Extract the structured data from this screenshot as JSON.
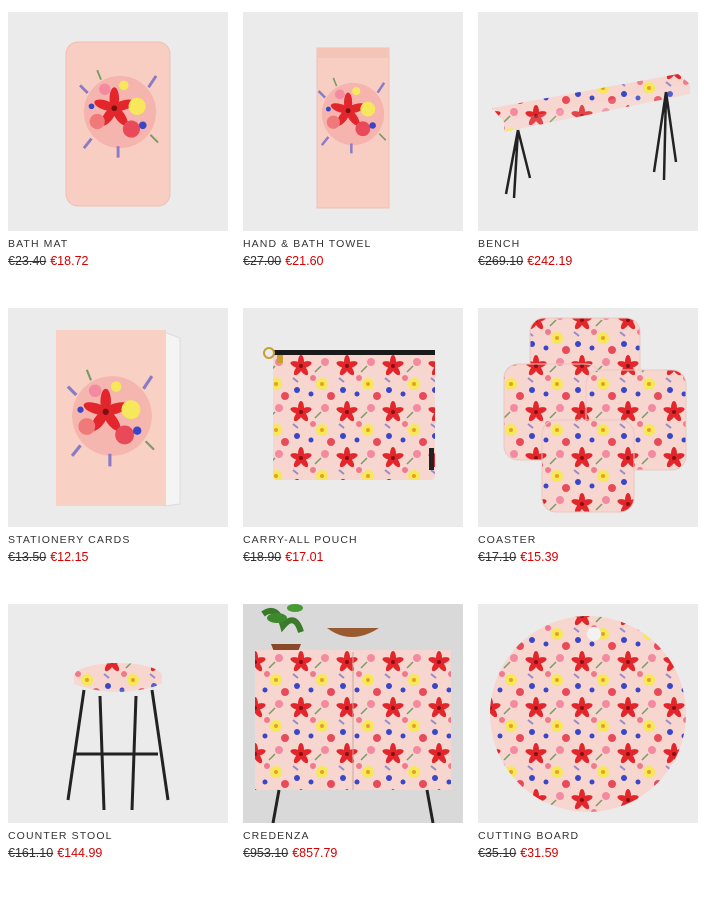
{
  "colors": {
    "sale_price": "#d60000",
    "original_price": "#333333",
    "thumb_background": "#ebebeb"
  },
  "products": [
    {
      "name": "BATH MAT",
      "original_price": "€23.40",
      "sale_price": "€18.72",
      "image": "bath-mat-image"
    },
    {
      "name": "HAND & BATH TOWEL",
      "original_price": "€27.00",
      "sale_price": "€21.60",
      "image": "towel-image"
    },
    {
      "name": "BENCH",
      "original_price": "€269.10",
      "sale_price": "€242.19",
      "image": "bench-image"
    },
    {
      "name": "STATIONERY CARDS",
      "original_price": "€13.50",
      "sale_price": "€12.15",
      "image": "stationery-card-image"
    },
    {
      "name": "CARRY-ALL POUCH",
      "original_price": "€18.90",
      "sale_price": "€17.01",
      "image": "pouch-image"
    },
    {
      "name": "COASTER",
      "original_price": "€17.10",
      "sale_price": "€15.39",
      "image": "coaster-image"
    },
    {
      "name": "COUNTER STOOL",
      "original_price": "€161.10",
      "sale_price": "€144.99",
      "image": "counter-stool-image"
    },
    {
      "name": "CREDENZA",
      "original_price": "€953.10",
      "sale_price": "€857.79",
      "image": "credenza-image"
    },
    {
      "name": "CUTTING BOARD",
      "original_price": "€35.10",
      "sale_price": "€31.59",
      "image": "cutting-board-image"
    }
  ]
}
